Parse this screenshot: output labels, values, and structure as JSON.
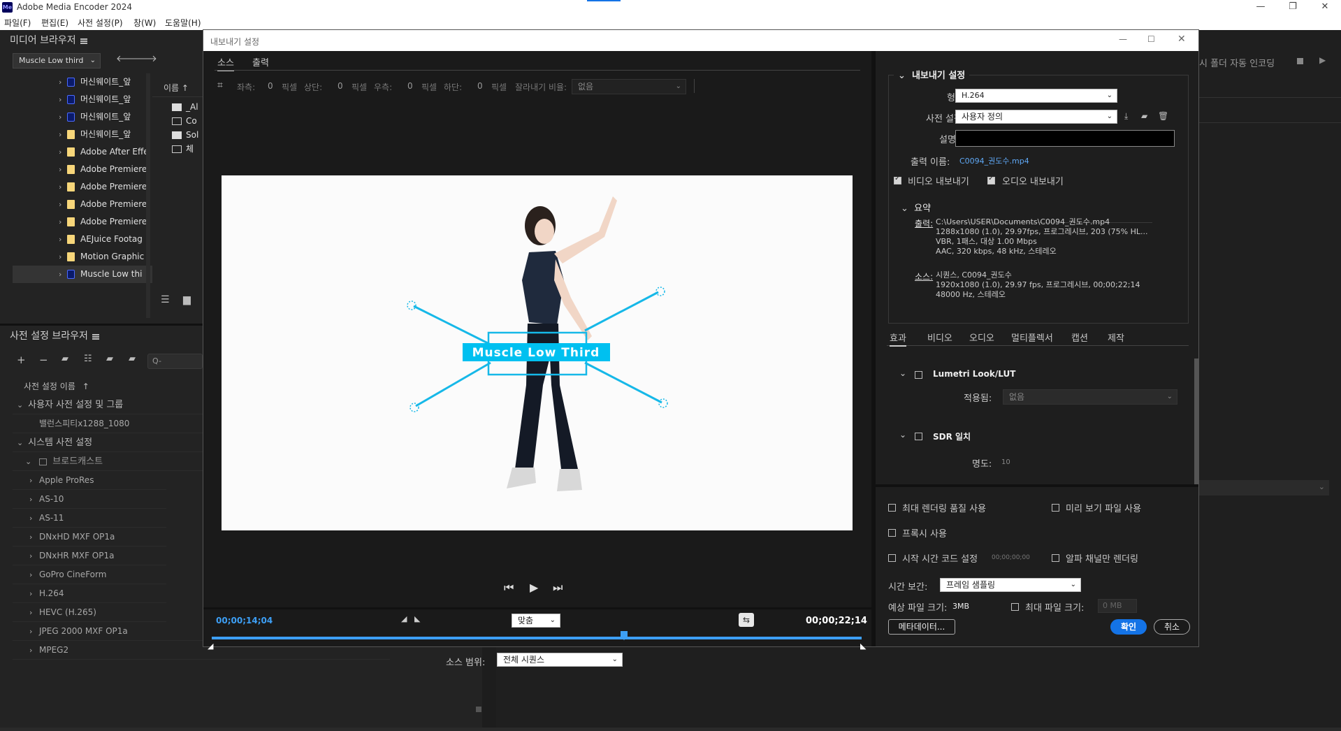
{
  "app": {
    "title": "Adobe Media Encoder 2024",
    "logo_text": "Me",
    "window_controls": [
      "—",
      "❐",
      "✕"
    ]
  },
  "menu": [
    "파일(F)",
    "편집(E)",
    "사전 설정(P)",
    "창(W)",
    "도움말(H)"
  ],
  "media_browser": {
    "title": "미디어 브라우저",
    "location": "Muscle Low third",
    "col_name": "이름",
    "tree": [
      {
        "label": "머신웨이트_앞",
        "icon": "ae"
      },
      {
        "label": "머신웨이트_앞",
        "icon": "ae"
      },
      {
        "label": "머신웨이트_앞",
        "icon": "ae"
      },
      {
        "label": "머신웨이트_앞",
        "icon": "folder"
      },
      {
        "label": "Adobe After Effe",
        "icon": "folder"
      },
      {
        "label": "Adobe Premiere",
        "icon": "folder"
      },
      {
        "label": "Adobe Premiere",
        "icon": "folder"
      },
      {
        "label": "Adobe Premiere",
        "icon": "folder"
      },
      {
        "label": "Adobe Premiere",
        "icon": "folder"
      },
      {
        "label": "AEJuice Footag",
        "icon": "folder"
      },
      {
        "label": "Motion Graphic",
        "icon": "folder"
      },
      {
        "label": "Muscle Low thi",
        "icon": "ae"
      }
    ],
    "files": [
      {
        "label": "_Al",
        "icon": "folder"
      },
      {
        "label": "Co",
        "icon": "comp"
      },
      {
        "label": "Sol",
        "icon": "folder"
      },
      {
        "label": "체",
        "icon": "comp"
      }
    ]
  },
  "preset_browser": {
    "title": "사전 설정 브라우저",
    "search_placeholder": "Q-",
    "col_name": "사전 설정 이름",
    "user_group": "사용자 사전 설정 및 그룹",
    "user_preset": "밸런스피티x1288_1080",
    "system_group": "시스템 사전 설정",
    "broadcast": "브로드캐스트",
    "items": [
      "Apple ProRes",
      "AS-10",
      "AS-11",
      "DNxHD MXF OP1a",
      "DNxHR MXF OP1a",
      "GoPro CineForm",
      "H.264",
      "HEVC (H.265)",
      "JPEG 2000 MXF OP1a",
      "MPEG2"
    ]
  },
  "queue_panel": {
    "auto_encode": "시 폴더 자동 인코딩"
  },
  "dialog": {
    "title": "내보내기 설정",
    "tabs": {
      "source": "소스",
      "output": "출력"
    },
    "crop": {
      "left": "좌측:",
      "left_val": "0",
      "px1": "픽셀",
      "top": "상단:",
      "top_val": "0",
      "px2": "픽셀",
      "right": "우측:",
      "right_val": "0",
      "px3": "픽셀",
      "bottom": "하단:",
      "bottom_val": "0",
      "px4": "픽셀",
      "ratio_label": "잘라내기 비율:",
      "ratio_value": "없음"
    },
    "preview": {
      "lower_third_text": "Muscle Low Third"
    },
    "timeline": {
      "current_tc": "00;00;14;04",
      "fit": "맞춤",
      "duration_tc": "00;00;22;14",
      "source_range_label": "소스 범위:",
      "source_range_value": "전체 시퀀스",
      "playhead_fraction": 0.634
    },
    "export_settings": {
      "header": "내보내기 설정",
      "format_label": "형식:",
      "format_value": "H.264",
      "preset_label": "사전 설정:",
      "preset_value": "사용자 정의",
      "comment_label": "설명:",
      "comment_value": "",
      "output_name_label": "출력 이름:",
      "output_name_value": "C0094_권도수.mp4",
      "export_video": "비디오 내보내기",
      "export_audio": "오디오 내보내기",
      "summary_header": "요약",
      "output_label": "출력:",
      "output_lines": [
        "C:\\Users\\USER\\Documents\\C0094_권도수.mp4",
        "1288x1080 (1.0), 29.97fps, 프로그레시브, 203 (75% HL...",
        "VBR, 1패스, 대상 1.00 Mbps",
        "AAC, 320 kbps, 48 kHz, 스테레오"
      ],
      "source_label": "소스:",
      "source_lines": [
        "시퀀스, C0094_권도수",
        "1920x1080 (1.0), 29.97 fps, 프로그레시브, 00;00;22;14",
        "48000 Hz, 스테레오"
      ]
    },
    "settings_tabs": [
      "효과",
      "비디오",
      "오디오",
      "멀티플렉서",
      "캡션",
      "제작"
    ],
    "effects": {
      "lumetri_label": "Lumetri Look/LUT",
      "applied_label": "적용됨:",
      "applied_value": "없음",
      "sdr_label": "SDR 일치",
      "brightness_label": "명도:",
      "brightness_value": "10"
    },
    "options": {
      "max_render": "최대 렌더링 품질 사용",
      "preview_files": "미리 보기 파일 사용",
      "proxy": "프록시 사용",
      "start_tc": "시작 시간 코드 설정",
      "start_tc_value": "00;00;00;00",
      "alpha_only": "알파 채널만 렌더링",
      "interp_label": "시간 보간:",
      "interp_value": "프레임 샘플링",
      "est_size_label": "예상 파일 크기:",
      "est_size_value": "3MB",
      "max_size_label": "최대 파일 크기:",
      "max_size_placeholder": "0 MB",
      "metadata_button": "메타데이터...",
      "ok_button": "확인",
      "cancel_button": "취소"
    }
  },
  "colors": {
    "accent": "#1473e6",
    "lower_third": "#00c0f0",
    "link": "#5fa8f5"
  }
}
